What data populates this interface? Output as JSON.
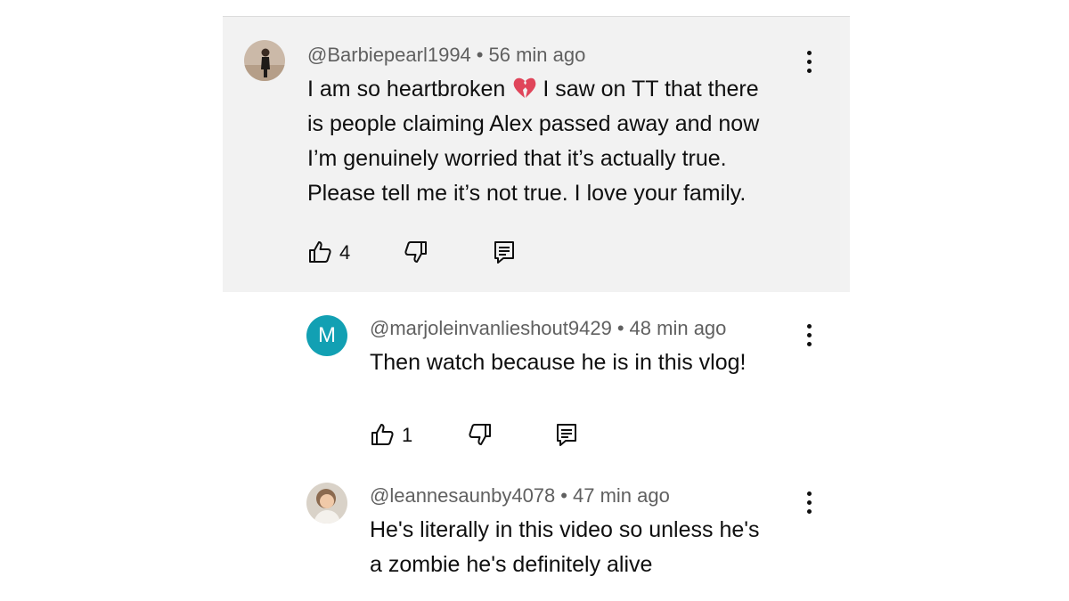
{
  "comments": [
    {
      "author": "@Barbiepearl1994",
      "time": "56 min ago",
      "lines": [
        "I am so heartbroken",
        "I saw on TT that there",
        "is people claiming Alex passed away and now",
        "I’m genuinely worried that it’s actually true.",
        "Please tell me it’s not true. I love your family."
      ],
      "emoji": "broken-heart-icon",
      "likes": "4",
      "avatar": "photo"
    },
    {
      "author": "@marjoleinvanlieshout9429",
      "time": "48 min ago",
      "lines": [
        "Then watch because he is in this vlog!"
      ],
      "likes": "1",
      "avatar_letter": "M",
      "avatar_color": "#12a0b3"
    },
    {
      "author": "@leannesaunby4078",
      "time": "47 min ago",
      "lines": [
        "He's literally in this video so unless he's",
        "a zombie he's definitely alive"
      ],
      "avatar": "photo"
    }
  ],
  "separator": "•",
  "colors": {
    "highlight_bg": "#f2f2f2",
    "meta_text": "#606060",
    "body_text": "#0f0f0f",
    "avatar_teal": "#12a0b3",
    "heart_red": "#e0455a"
  }
}
